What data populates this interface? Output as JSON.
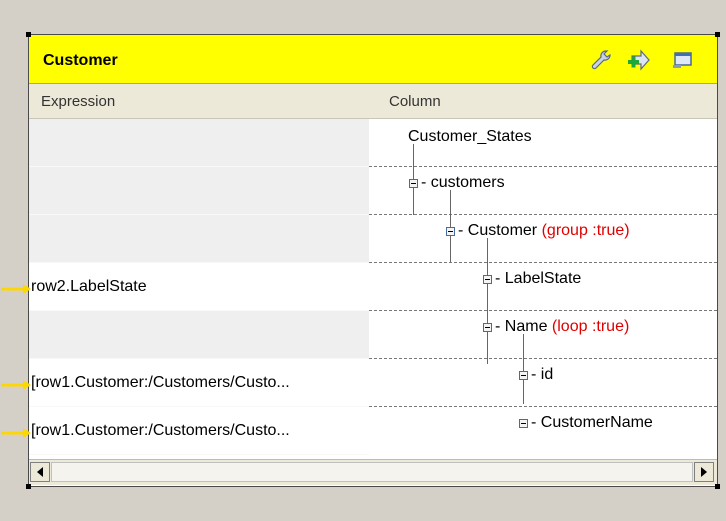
{
  "table": {
    "title": "Customer",
    "toolbar": {
      "icons": [
        "wrench-icon",
        "add-output-icon",
        "window-icon"
      ]
    },
    "headers": {
      "expression": "Expression",
      "column": "Column"
    },
    "expressions": [
      "",
      "",
      "",
      "row2.LabelState",
      "",
      "[row1.Customer:/Customers/Custo...",
      "[row1.Customer:/Customers/Custo..."
    ],
    "tree": [
      {
        "label": "Customer_States",
        "attr": ""
      },
      {
        "label": "customers",
        "attr": ""
      },
      {
        "label": "Customer",
        "attr": "(group :true)"
      },
      {
        "label": "LabelState",
        "attr": ""
      },
      {
        "label": "Name",
        "attr": "(loop :true)"
      },
      {
        "label": "id",
        "attr": ""
      },
      {
        "label": "CustomerName",
        "attr": ""
      }
    ]
  },
  "colors": {
    "title_bar": "#ffff00",
    "link_arrow": "#ffd700",
    "attribute_text": "#e00000"
  }
}
